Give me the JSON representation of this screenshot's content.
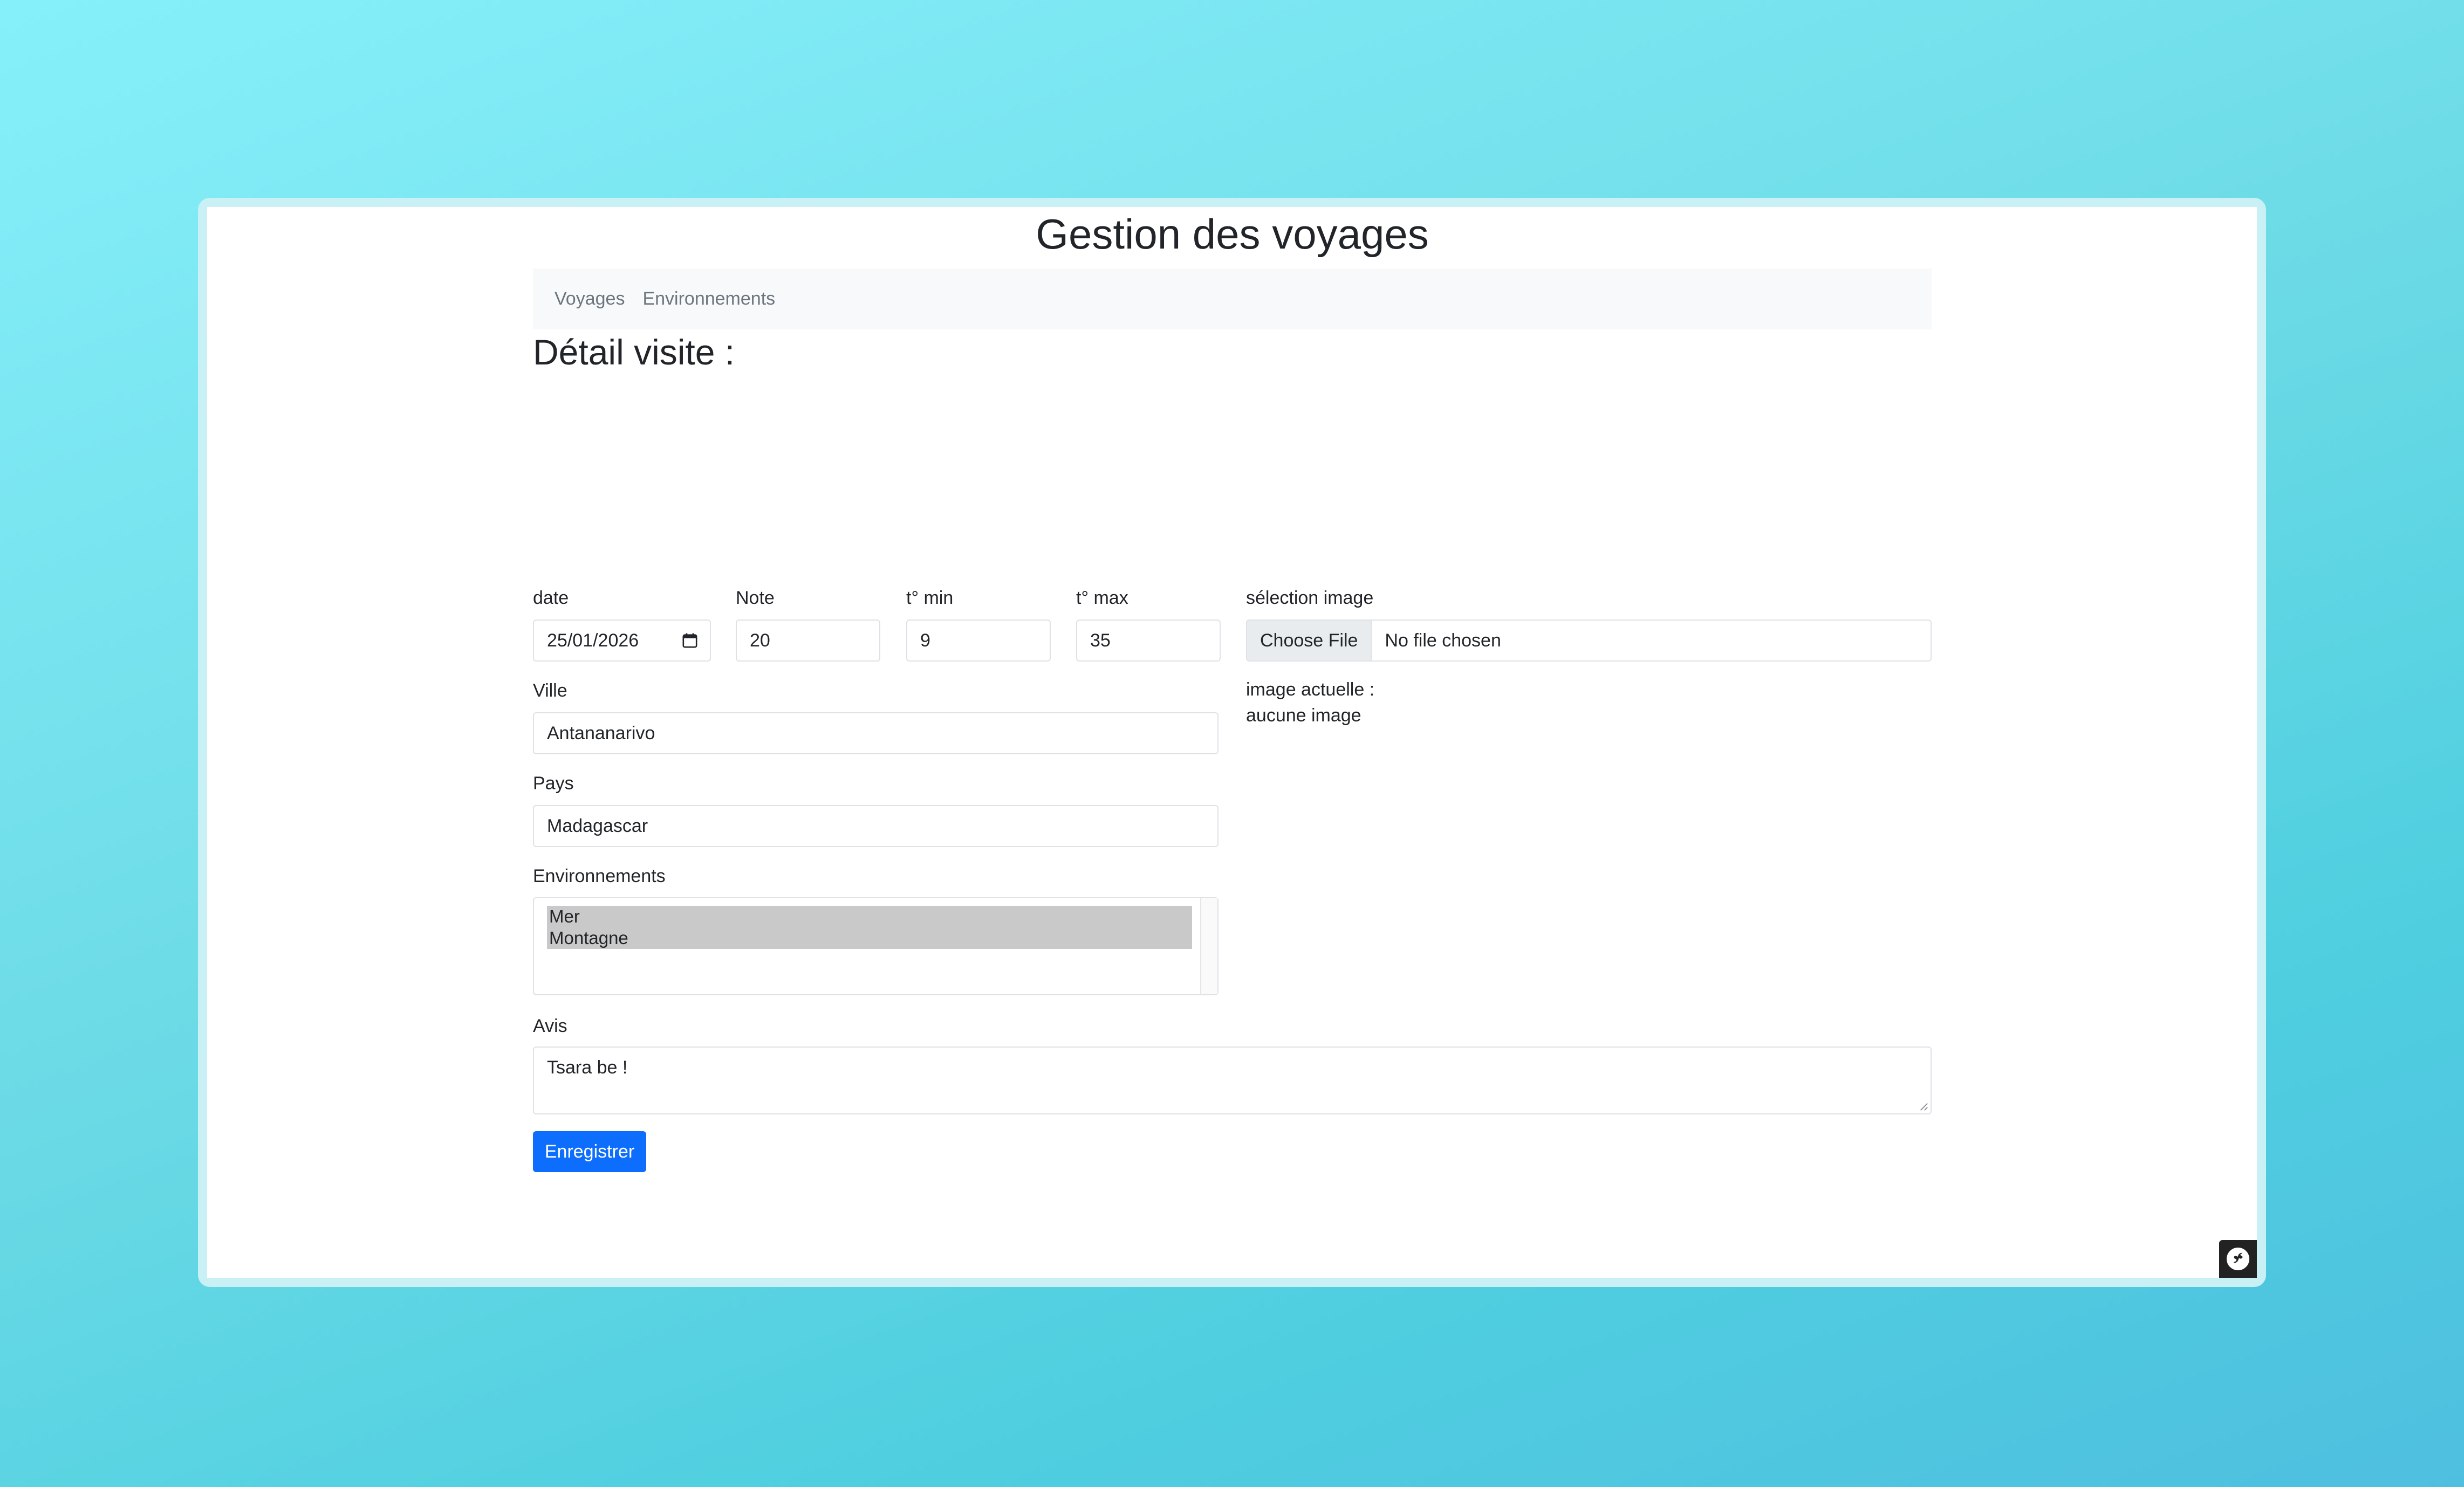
{
  "header": {
    "title": "Gestion des voyages"
  },
  "nav": {
    "items": [
      "Voyages",
      "Environnements"
    ]
  },
  "form": {
    "section_title": "Détail visite :",
    "date": {
      "label": "date",
      "value": "25/01/2026"
    },
    "note": {
      "label": "Note",
      "value": "20"
    },
    "tmin": {
      "label": "t° min",
      "value": "9"
    },
    "tmax": {
      "label": "t° max",
      "value": "35"
    },
    "image": {
      "label": "sélection image",
      "button": "Choose File",
      "status": "No file chosen",
      "current_label": "image actuelle :",
      "current_value": "aucune image"
    },
    "ville": {
      "label": "Ville",
      "value": "Antananarivo"
    },
    "pays": {
      "label": "Pays",
      "value": "Madagascar"
    },
    "environnements": {
      "label": "Environnements",
      "options": [
        "Mer",
        "Montagne"
      ]
    },
    "avis": {
      "label": "Avis",
      "value": "Tsara be !"
    },
    "submit": "Enregistrer"
  },
  "colors": {
    "primary": "#0d6efd",
    "navbar_bg": "#f8f9fa",
    "text": "#212529",
    "muted": "#6c757d"
  },
  "icons": [
    "calendar-icon",
    "symfony-icon"
  ]
}
